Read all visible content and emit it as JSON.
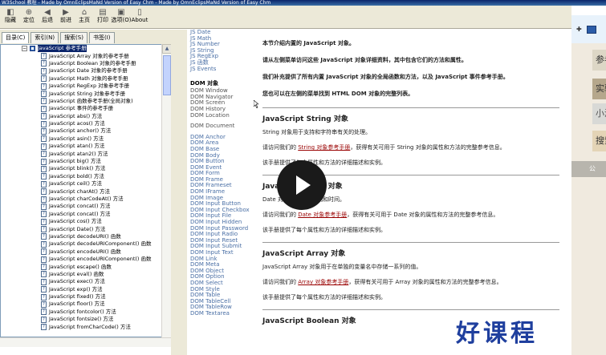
{
  "window": {
    "title": "W3School 教程 - Made by OmnEclipsMaNd Version of Easy Chm - Made by OmnEclipsMaNd Version of Easy Chm"
  },
  "toolbar": [
    {
      "label": "隐藏"
    },
    {
      "label": "定位"
    },
    {
      "label": "后退"
    },
    {
      "label": "前进"
    },
    {
      "label": "主页"
    },
    {
      "label": "打印"
    },
    {
      "label": "选项(O)"
    },
    {
      "label": "About"
    }
  ],
  "tabs": [
    {
      "label": "目录(C)",
      "active": true
    },
    {
      "label": "索引(N)",
      "active": false
    },
    {
      "label": "搜索(S)",
      "active": false
    },
    {
      "label": "书签(I)",
      "active": false
    }
  ],
  "tree": {
    "root": "JavaScript 参考手册",
    "items": [
      "JavaScript Array 对象的参考手册",
      "JavaScript Boolean 对象的参考手册",
      "JavaScript Date 对象的参考手册",
      "JavaScript Math 对象的参考手册",
      "JavaScript RegExp 对象参考手册",
      "JavaScript String 对象参考手册",
      "JavaScript 函数参考手册(全局对象)",
      "JavaScript 事件的参考手册",
      "JavaScript abs() 方法",
      "JavaScript acos() 方法",
      "JavaScript anchor() 方法",
      "JavaScript asin() 方法",
      "JavaScript atan() 方法",
      "JavaScript atan2() 方法",
      "JavaScript big() 方法",
      "JavaScript blink() 方法",
      "JavaScript bold() 方法",
      "JavaScript ceil() 方法",
      "JavaScript charAt() 方法",
      "JavaScript charCodeAt() 方法",
      "JavaScript concat() 方法",
      "JavaScript concat() 方法",
      "JavaScript cos() 方法",
      "JavaScript Date() 方法",
      "JavaScript decodeURI() 函数",
      "JavaScript decodeURIComponent() 函数",
      "JavaScript encodeURI() 函数",
      "JavaScript encodeURIComponent() 函数",
      "JavaScript escape() 函数",
      "JavaScript eval() 函数",
      "JavaScript exec() 方法",
      "JavaScript exp() 方法",
      "JavaScript fixed() 方法",
      "JavaScript floor() 方法",
      "JavaScript fontcolor() 方法",
      "JavaScript fontsize() 方法",
      "JavaScript fromCharCode() 方法"
    ]
  },
  "leftnav": {
    "js_items": [
      "JS Date",
      "JS Math",
      "JS Number",
      "JS String",
      "JS RegExp",
      "JS 函数",
      "JS Events"
    ],
    "dom_heading": "DOM 对象",
    "dom_group1": [
      "DOM Window",
      "DOM Navigator",
      "DOM Screen",
      "DOM History",
      "DOM Location"
    ],
    "dom_group2": [
      "DOM Document"
    ],
    "dom_group3": [
      "DOM Anchor",
      "DOM Area",
      "DOM Base",
      "DOM Body",
      "DOM Button",
      "DOM Event",
      "DOM Form",
      "DOM Frame",
      "DOM Frameset",
      "DOM IFrame",
      "DOM Image",
      "DOM Input Button",
      "DOM Input Checkbox",
      "DOM Input File",
      "DOM Input Hidden",
      "DOM Input Password",
      "DOM Input Radio",
      "DOM Input Reset",
      "DOM Input Submit",
      "DOM Input Text",
      "DOM Link",
      "DOM Meta",
      "DOM Object",
      "DOM Option",
      "DOM Select",
      "DOM Style",
      "DOM Table",
      "DOM TableCell",
      "DOM TableRow",
      "DOM Textarea"
    ]
  },
  "main": {
    "intro": [
      "本节介绍内置的 JavaScript 对象。",
      "请从左侧菜单访问这些 JavaScript 对象详细资料，其中包含它们的方法和属性。",
      "我们补充提供了所有内置 JavaScript 对象的全局函数和方法，以及 JavaScript 事件参考手册。",
      "您也可以在左侧的菜单找到 HTML DOM 对象的完整列表。"
    ],
    "sections": [
      {
        "title": "JavaScript String 对象",
        "desc": "String 对象用于支持和字符串有关的处理。",
        "pre": "请访问我们的",
        "link": "String 对象参考手册",
        "post": "，获得有关可用于 String 对象的属性和方法的完整参考信息。",
        "note": "该手册提供了每个属性和方法的详细描述和实例。"
      },
      {
        "title": "JavaScript Date 对象",
        "desc": "Date 对象用于处理日期和时间。",
        "pre": "请访问我们的",
        "link": "Date 对象参考手册",
        "post": "，获得有关可用于 Date 对象的属性和方法的完整参考信息。",
        "note": "该手册提供了每个属性和方法的详细描述和实例。"
      },
      {
        "title": "JavaScript Array 对象",
        "desc": "JavaScript Array 对象用于在单独的变量名中存储一系列的值。",
        "pre": "请访问我们的",
        "link": "Array 对象参考手册",
        "post": "，获得有关可用于 Array 对象的属性和方法的完整参考信息。",
        "note": "该手册提供了每个属性和方法的详细描述和实例。"
      },
      {
        "title": "JavaScript Boolean 对象",
        "desc": "",
        "pre": "",
        "link": "",
        "post": "",
        "note": ""
      }
    ]
  },
  "sidepanel": {
    "buttons": [
      "参考",
      "实验",
      "小测",
      "搜索"
    ],
    "strip": "公"
  },
  "watermark": "好课程"
}
